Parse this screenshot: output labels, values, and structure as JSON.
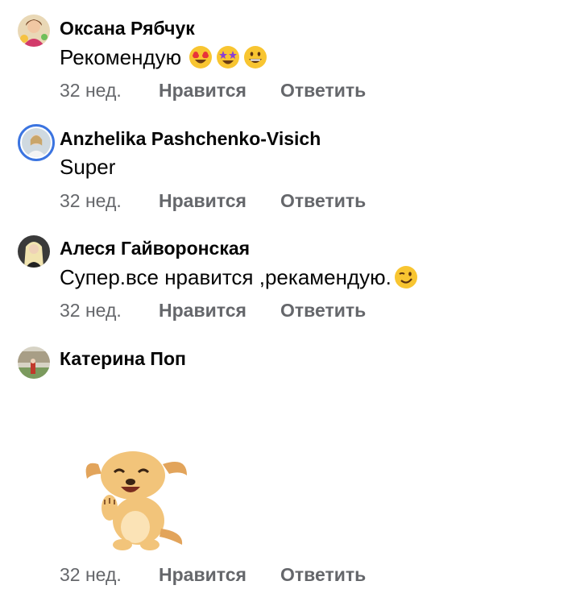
{
  "comments": [
    {
      "author": "Оксана Рябчук",
      "text": "Рекомендую",
      "emojis": [
        "heart-eyes-emoji",
        "star-struck-emoji",
        "grinning-emoji"
      ],
      "time": "32 нед.",
      "like_label": "Нравится",
      "reply_label": "Ответить"
    },
    {
      "author": "Anzhelika Pashchenko-Visich",
      "text": "Super",
      "time": "32 нед.",
      "like_label": "Нравится",
      "reply_label": "Ответить"
    },
    {
      "author": "Алеся Гайворонская",
      "text": "Супер.все нравится ,рекамендую.",
      "emojis": [
        "winking-emoji"
      ],
      "time": "32 нед.",
      "like_label": "Нравится",
      "reply_label": "Ответить"
    },
    {
      "author": "Катерина Поп",
      "sticker": "puppy-sticker",
      "time": "32 нед.",
      "like_label": "Нравится",
      "reply_label": "Ответить"
    }
  ],
  "colors": {
    "text": "#050505",
    "meta": "#65676b",
    "story_ring": "#3b74e0"
  }
}
